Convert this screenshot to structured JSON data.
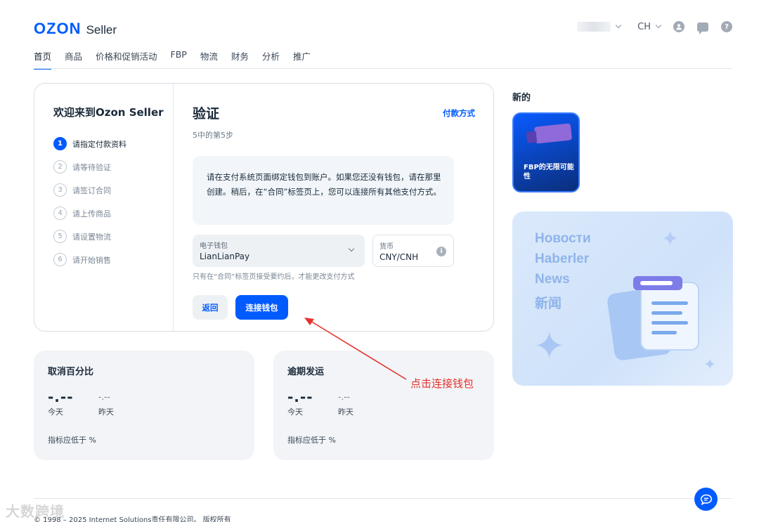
{
  "header": {
    "logo_brand": "OZON",
    "logo_suffix": "Seller",
    "language": "CH"
  },
  "nav": [
    "首页",
    "商品",
    "价格和促销活动",
    "FBP",
    "物流",
    "财务",
    "分析",
    "推广"
  ],
  "steps": {
    "title": "欢迎来到Ozon Seller",
    "items": [
      {
        "num": "1",
        "label": "请指定付款资料"
      },
      {
        "num": "2",
        "label": "请等待验证"
      },
      {
        "num": "3",
        "label": "请签订合同"
      },
      {
        "num": "4",
        "label": "请上传商品"
      },
      {
        "num": "5",
        "label": "请设置物流"
      },
      {
        "num": "6",
        "label": "请开始销售"
      }
    ]
  },
  "verify": {
    "title": "验证",
    "subtitle": "5中的第5步",
    "payment_link": "付款方式",
    "info": "请在支付系统页面绑定钱包到账户。如果您还没有钱包，请在那里创建。稍后，在“合同”标签页上，您可以连接所有其他支付方式。",
    "wallet_label": "电子钱包",
    "wallet_value": "LianLianPay",
    "currency_label": "货币",
    "currency_value": "CNY/CNH",
    "hint": "只有在“合同”标签页接受要约后，才能更改支付方式",
    "back_button": "返回",
    "connect_button": "连接钱包"
  },
  "stats": [
    {
      "title": "取消百分比",
      "today_value": "-.--",
      "yesterday_value": "-.--",
      "today_label": "今天",
      "yesterday_label": "昨天",
      "note": "指标应低于 %"
    },
    {
      "title": "逾期发运",
      "today_value": "-.--",
      "yesterday_value": "-.--",
      "today_label": "今天",
      "yesterday_label": "昨天",
      "note": "指标应低于 %"
    }
  ],
  "sidebar": {
    "new_title": "新的",
    "story_text": "FBP的无限可能性",
    "news_lines": [
      "Новости",
      "Haberler",
      "News",
      "新闻"
    ]
  },
  "annotation": "点击连接钱包",
  "footer": {
    "copyright": "© 1998 – 2025 Internet Solutions责任有限公司。 版权所有",
    "watermark": "大数跨境"
  },
  "colors": {
    "brand": "#005bff",
    "annotation": "#e5322d"
  }
}
